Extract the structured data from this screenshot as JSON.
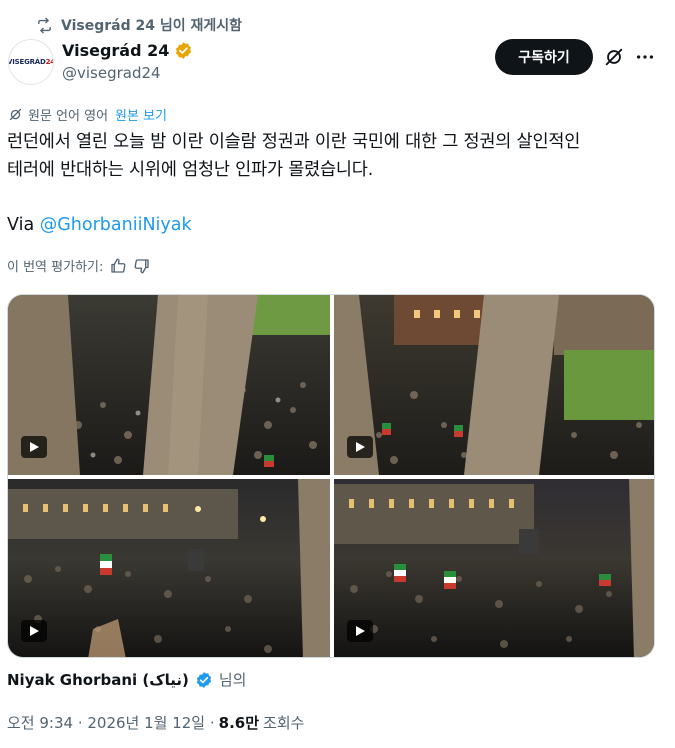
{
  "repost": {
    "label": "Visegrád 24 님이 재게시함"
  },
  "author": {
    "display_name": "Visegrád 24",
    "handle": "@visegrad24",
    "avatar_text_main": "VISEGRÁD",
    "avatar_text_num": "24",
    "verified_color": "#e8a400"
  },
  "actions": {
    "subscribe_label": "구독하기"
  },
  "translation": {
    "label": "원문 언어 영어",
    "show_original": "원본 보기"
  },
  "tweet": {
    "line1": "런던에서 열린 오늘 밤 이란 이슬람 정권과 이란 국민에 대한 그 정권의 살인적인",
    "line2": "테러에 반대하는 시위에 엄청난 인파가 몰렸습니다.",
    "via_prefix": "Via ",
    "via_mention": "@GhorbaniiNiyak"
  },
  "rate": {
    "label": "이 번역 평가하기:"
  },
  "media": [
    {
      "kind": "video"
    },
    {
      "kind": "video"
    },
    {
      "kind": "video"
    },
    {
      "kind": "video"
    }
  ],
  "credit": {
    "name": "Niyak Ghorbani (نیاک)",
    "suffix": "님의",
    "verified_color": "#1d9bf0"
  },
  "meta": {
    "time": "오전 9:34 · 2026년 1월 12일 ·",
    "views": "8.6만",
    "views_label": "조회수"
  },
  "colors": {
    "accent": "#1d9bf0",
    "text": "#0f1419",
    "muted": "#536471"
  }
}
